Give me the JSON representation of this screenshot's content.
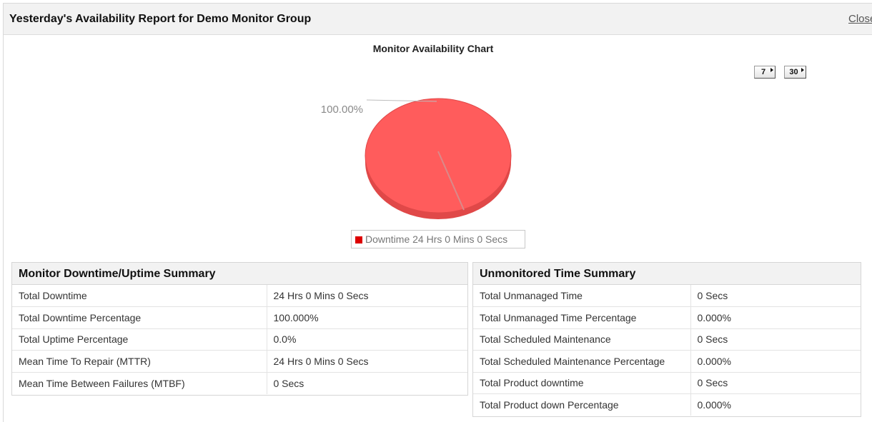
{
  "header": {
    "title": "Yesterday's Availability Report for Demo Monitor Group",
    "close_label": "Close"
  },
  "chart_title": "Monitor Availability Chart",
  "period_buttons": [
    "7",
    "30"
  ],
  "colors": {
    "downtime": "#ff5c5c",
    "downtime_edge": "#e04848",
    "legend_swatch": "#dd0000"
  },
  "chart_data": {
    "type": "pie",
    "slices": [
      {
        "label": "Downtime 24 Hrs 0 Mins 0 Secs",
        "value": 100.0,
        "display": "100.00%"
      }
    ],
    "legend": "bottom"
  },
  "downtime_summary": {
    "title": "Monitor Downtime/Uptime Summary",
    "rows": [
      {
        "label": "Total Downtime",
        "value": "24 Hrs 0 Mins 0 Secs"
      },
      {
        "label": "Total Downtime Percentage",
        "value": "100.000%"
      },
      {
        "label": "Total Uptime Percentage",
        "value": "0.0%"
      },
      {
        "label": "Mean Time To Repair (MTTR)",
        "value": "24 Hrs 0 Mins 0 Secs"
      },
      {
        "label": "Mean Time Between Failures (MTBF)",
        "value": "0 Secs"
      }
    ]
  },
  "unmonitored_summary": {
    "title": "Unmonitored Time Summary",
    "rows": [
      {
        "label": "Total Unmanaged Time",
        "value": "0 Secs"
      },
      {
        "label": "Total Unmanaged Time Percentage",
        "value": "0.000%"
      },
      {
        "label": "Total Scheduled Maintenance",
        "value": "0 Secs"
      },
      {
        "label": "Total Scheduled Maintenance Percentage",
        "value": "0.000%"
      },
      {
        "label": "Total Product downtime",
        "value": "0 Secs"
      },
      {
        "label": "Total Product down Percentage",
        "value": "0.000%"
      }
    ]
  }
}
